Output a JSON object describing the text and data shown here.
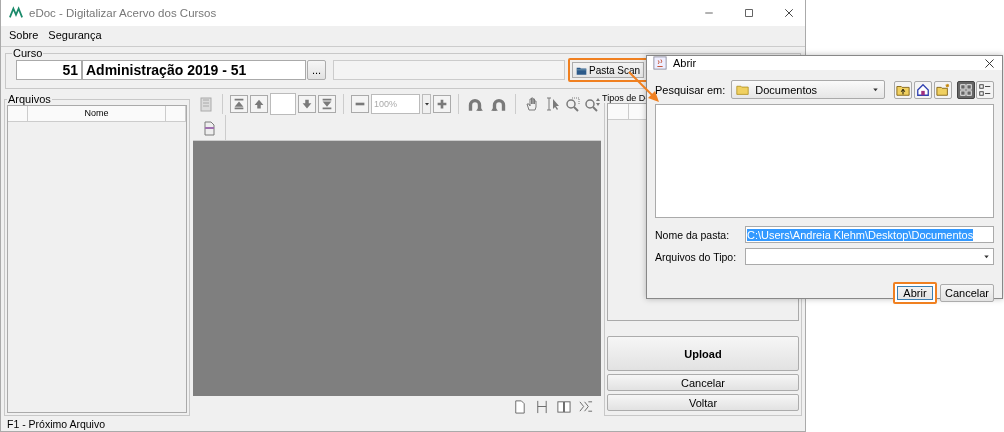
{
  "window": {
    "title": "eDoc - Digitalizar Acervo dos Cursos"
  },
  "menu": [
    "Sobre",
    "Segurança"
  ],
  "curso": {
    "label": "Curso",
    "code": "51",
    "name": "Administração 2019 - 51",
    "browse_button": "...",
    "pasta_scan_button": {
      "label": "Pasta Scan",
      "highlighted": true
    }
  },
  "arquivos": {
    "label": "Arquivos",
    "columns": [
      "Nome"
    ]
  },
  "viewer": {
    "zoom": "100%"
  },
  "tipos": {
    "label": "Tipos de D"
  },
  "buttons": [
    "Upload",
    "Cancelar",
    "Voltar"
  ],
  "status": "F1 - Próximo Arquivo",
  "dialog": {
    "title": "Abrir",
    "look_in_label": "Pesquisar em:",
    "look_in": "Documentos",
    "view_modes": [
      {
        "kind": "list",
        "selected": true
      },
      {
        "kind": "details",
        "selected": false
      }
    ],
    "folder_label": "Nome da pasta:",
    "folder": "C:\\Users\\Andreia Klehm\\Desktop\\Documentos",
    "folder_selected": true,
    "type_label": "Arquivos do Tipo:",
    "buttons": [
      {
        "label": "Abrir",
        "highlighted": true
      },
      {
        "label": "Cancelar",
        "highlighted": false
      }
    ]
  }
}
